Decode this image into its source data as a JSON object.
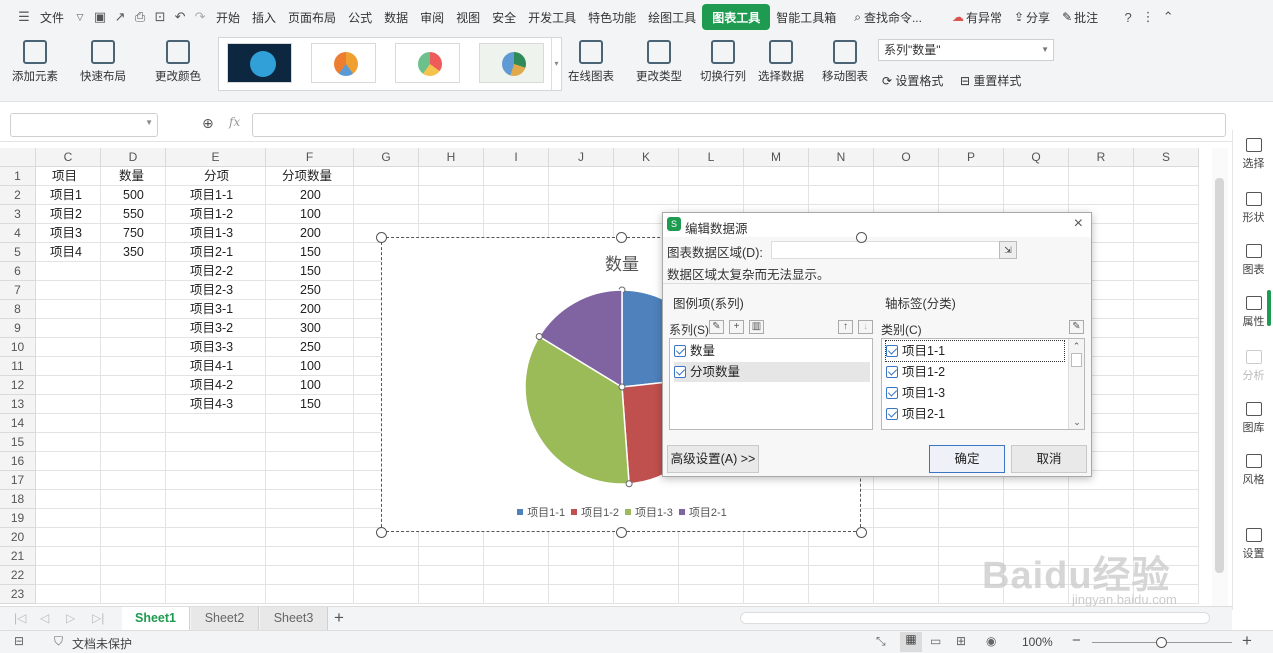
{
  "titlebar": {
    "file_menu": "文件",
    "tabs": [
      "开始",
      "插入",
      "页面布局",
      "公式",
      "数据",
      "审阅",
      "视图",
      "安全",
      "开发工具",
      "特色功能",
      "绘图工具",
      "图表工具",
      "智能工具箱"
    ],
    "active_tab": "图表工具",
    "search": "查找命令...",
    "cloud": "有异常",
    "share": "分享",
    "annotate": "批注"
  },
  "ribbon": {
    "add_element": "添加元素",
    "quick_layout": "快速布局",
    "change_color": "更改颜色",
    "online_chart": "在线图表",
    "change_type": "更改类型",
    "switch_rowcol": "切换行列",
    "select_data": "选择数据",
    "move_chart": "移动图表",
    "series_select": "系列\"数量\"",
    "set_format": "设置格式",
    "reset_style": "重置样式"
  },
  "formula": {
    "fx": "fx"
  },
  "columns": [
    "C",
    "D",
    "E",
    "F",
    "G",
    "H",
    "I",
    "J",
    "K",
    "L",
    "M",
    "N",
    "O",
    "P",
    "Q",
    "R",
    "S"
  ],
  "rows": [
    "1",
    "2",
    "3",
    "4",
    "5",
    "6",
    "7",
    "8",
    "9",
    "10",
    "11",
    "12",
    "13",
    "14",
    "15",
    "16",
    "17",
    "18",
    "19",
    "20",
    "21",
    "22",
    "23"
  ],
  "table": {
    "c_header": "项目",
    "d_header": "数量",
    "e_header": "分项",
    "f_header": "分项数量",
    "c": [
      "项目1",
      "项目2",
      "项目3",
      "项目4"
    ],
    "d": [
      "500",
      "550",
      "750",
      "350"
    ],
    "e": [
      "项目1-1",
      "项目1-2",
      "项目1-3",
      "项目2-1",
      "项目2-2",
      "项目2-3",
      "项目3-1",
      "项目3-2",
      "项目3-3",
      "项目4-1",
      "项目4-2",
      "项目4-3"
    ],
    "f": [
      "200",
      "100",
      "200",
      "150",
      "150",
      "250",
      "200",
      "300",
      "250",
      "100",
      "100",
      "150"
    ]
  },
  "chart_data": {
    "type": "pie",
    "title": "数量",
    "categories": [
      "项目1-1",
      "项目1-2",
      "项目1-3",
      "项目2-1"
    ],
    "values": [
      500,
      550,
      750,
      350
    ],
    "colors": [
      "#4f81bd",
      "#c0504d",
      "#9bbb59",
      "#8064a2"
    ]
  },
  "dialog": {
    "title": "编辑数据源",
    "range_label": "图表数据区域(D):",
    "warning": "数据区域太复杂而无法显示。",
    "legend_section": "图例项(系列)",
    "axis_section": "轴标签(分类)",
    "series_label": "系列(S)",
    "category_label": "类别(C)",
    "series": [
      "数量",
      "分项数量"
    ],
    "categories": [
      "项目1-1",
      "项目1-2",
      "项目1-3",
      "项目2-1"
    ],
    "advanced": "高级设置(A) >>",
    "ok": "确定",
    "cancel": "取消"
  },
  "right_panel": [
    "选择",
    "形状",
    "图表",
    "属性",
    "分析",
    "图库",
    "风格",
    "设置"
  ],
  "sheets": [
    "Sheet1",
    "Sheet2",
    "Sheet3"
  ],
  "status": {
    "protect": "文档未保护",
    "zoom": "100%"
  },
  "watermark": {
    "brand": "Baidu经验",
    "url": "jingyan.baidu.com"
  }
}
